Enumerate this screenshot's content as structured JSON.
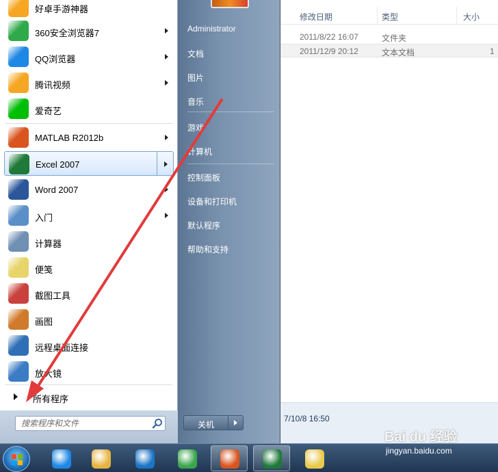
{
  "explorer": {
    "columns": [
      "修改日期",
      "类型",
      "大小"
    ],
    "rows": [
      {
        "date": "2011/8/22 16:07",
        "type": "文件夹",
        "size": ""
      },
      {
        "date": "2011/12/9 20:12",
        "type": "文本文档",
        "size": "1"
      }
    ],
    "details_date": "7/10/8 16:50"
  },
  "start_menu": {
    "programs": [
      {
        "label": "好卓手游神器",
        "icon": "haozhuo-icon",
        "color": "#f6a623",
        "arrow": false
      },
      {
        "label": "360安全浏览器7",
        "icon": "browser-360-icon",
        "color": "#2fa94a",
        "arrow": true
      },
      {
        "label": "QQ浏览器",
        "icon": "qq-browser-icon",
        "color": "#1e88e5",
        "arrow": true
      },
      {
        "label": "腾讯视频",
        "icon": "tencent-video-icon",
        "color": "#f5a623",
        "arrow": true
      },
      {
        "label": "爱奇艺",
        "icon": "iqiyi-icon",
        "color": "#00be06",
        "arrow": false
      },
      {
        "label": "MATLAB R2012b",
        "icon": "matlab-icon",
        "color": "#d9541e",
        "arrow": true
      },
      {
        "label": "Excel 2007",
        "icon": "excel-icon",
        "color": "#1f7a3a",
        "arrow": true
      },
      {
        "label": "Word 2007",
        "icon": "word-icon",
        "color": "#2b579a",
        "arrow": true
      },
      {
        "label": "入门",
        "icon": "getting-started-icon",
        "color": "#5a8fc7",
        "arrow": true
      },
      {
        "label": "计算器",
        "icon": "calculator-icon",
        "color": "#6f8fb3",
        "arrow": false
      },
      {
        "label": "便笺",
        "icon": "sticky-notes-icon",
        "color": "#e7d56a",
        "arrow": false
      },
      {
        "label": "截图工具",
        "icon": "snipping-tool-icon",
        "color": "#c9413c",
        "arrow": false
      },
      {
        "label": "画图",
        "icon": "paint-icon",
        "color": "#d07a2b",
        "arrow": false
      },
      {
        "label": "远程桌面连接",
        "icon": "remote-desktop-icon",
        "color": "#2f6fb5",
        "arrow": false
      },
      {
        "label": "放大镜",
        "icon": "magnifier-icon",
        "color": "#3b7cc4",
        "arrow": false
      }
    ],
    "all_programs": "所有程序",
    "search_placeholder": "搜索程序和文件",
    "right_items": [
      "Administrator",
      "文档",
      "图片",
      "音乐",
      "游戏",
      "计算机",
      "控制面板",
      "设备和打印机",
      "默认程序",
      "帮助和支持"
    ],
    "shutdown_label": "关机"
  },
  "taskbar": {
    "apps": [
      {
        "name": "ie-icon",
        "color": "#1e88e5"
      },
      {
        "name": "file-explorer-icon",
        "color": "#e8b440"
      },
      {
        "name": "kugou-icon",
        "color": "#1b74c5"
      },
      {
        "name": "browser-360-icon",
        "color": "#3aa64b"
      },
      {
        "name": "matlab-icon",
        "color": "#d9541e"
      },
      {
        "name": "excel-icon",
        "color": "#1f7a3a"
      },
      {
        "name": "notepad-icon",
        "color": "#e9c94a"
      }
    ]
  },
  "watermark": {
    "brand": "Bai du 经验",
    "url": "jingyan.baidu.com"
  },
  "colors": {
    "annotation_arrow": "#e23b3b",
    "highlight_border": "#7da2ce"
  }
}
